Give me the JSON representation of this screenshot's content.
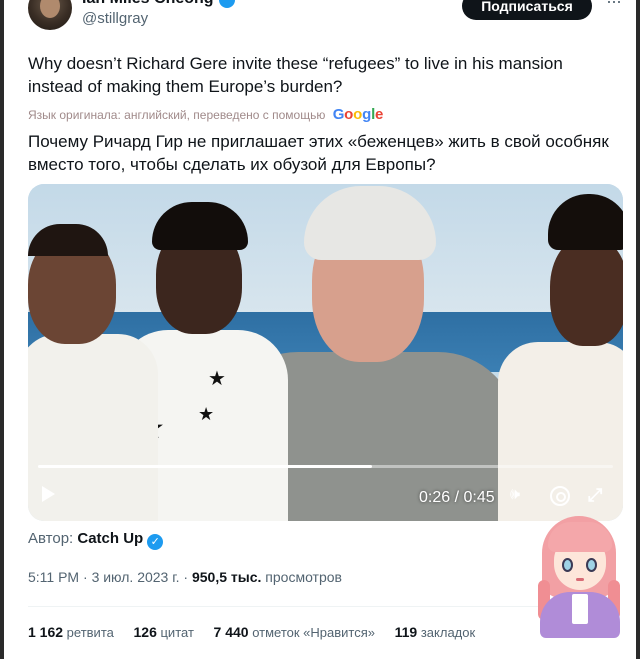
{
  "header": {
    "user_name": "Ian Miles Cheong",
    "user_handle": "@stillgray",
    "subscribe_label": "Подписаться",
    "more_label": "···"
  },
  "tweet": {
    "text": "Why doesn’t Richard Gere invite these “refugees” to live in his mansion instead of making them Europe’s burden?",
    "translation_note": "Язык оригинала: английский, переведено с помощью",
    "translation_provider": "Google",
    "translated_text": "Почему Ричард Гир не приглашает этих «беженцев» жить в свой особняк вместо того, чтобы сделать их обузой для Европы?"
  },
  "video": {
    "time": "0:26 / 0:45",
    "progress": 0.58
  },
  "author": {
    "label": "Автор:",
    "name": "Catch Up",
    "verified_mark": "✓"
  },
  "meta": {
    "time": "5:11 PM",
    "separator": "·",
    "date": "3 июл. 2023 г.",
    "views_count": "950,5 тыс.",
    "views_label": "просмотров"
  },
  "stats": {
    "retweets_count": "1 162",
    "retweets_label": "ретвита",
    "quotes_count": "126",
    "quotes_label": "цитат",
    "likes_count": "7 440",
    "likes_label": "отметок «Нравится»",
    "bookmarks_count": "119",
    "bookmarks_label": "закладок"
  },
  "colors": {
    "accent": "#1d9bf0",
    "text": "#0f1419",
    "muted": "#536471"
  }
}
